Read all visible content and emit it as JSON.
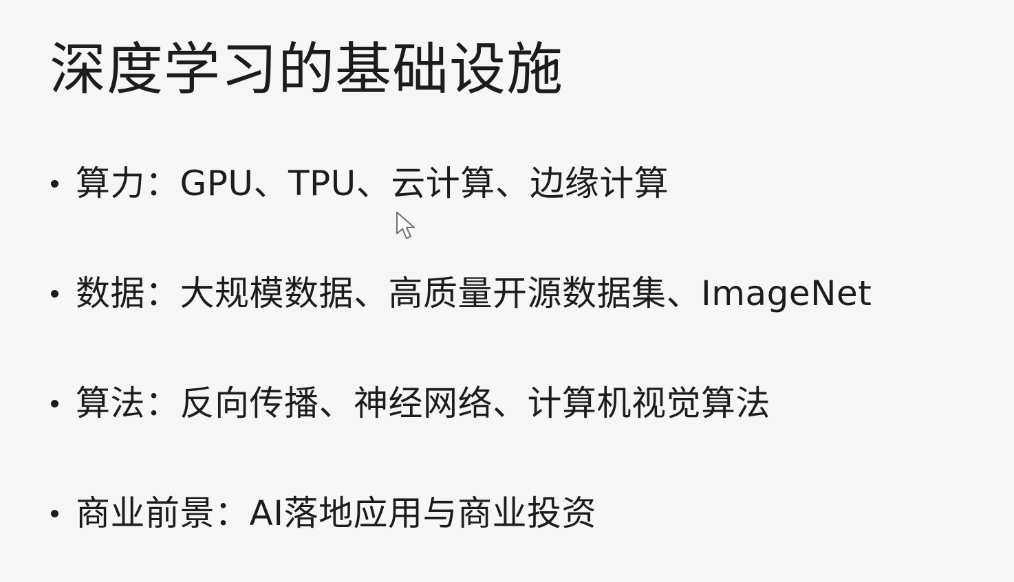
{
  "slide": {
    "title": "深度学习的基础设施",
    "bullets": [
      {
        "text": "算力：GPU、TPU、云计算、边缘计算"
      },
      {
        "text": "数据：大规模数据、高质量开源数据集、ImageNet"
      },
      {
        "text": "算法：反向传播、神经网络、计算机视觉算法"
      },
      {
        "text": "商业前景：AI落地应用与商业投资"
      }
    ]
  },
  "icons": {
    "cursor": "mouse-pointer-icon"
  }
}
